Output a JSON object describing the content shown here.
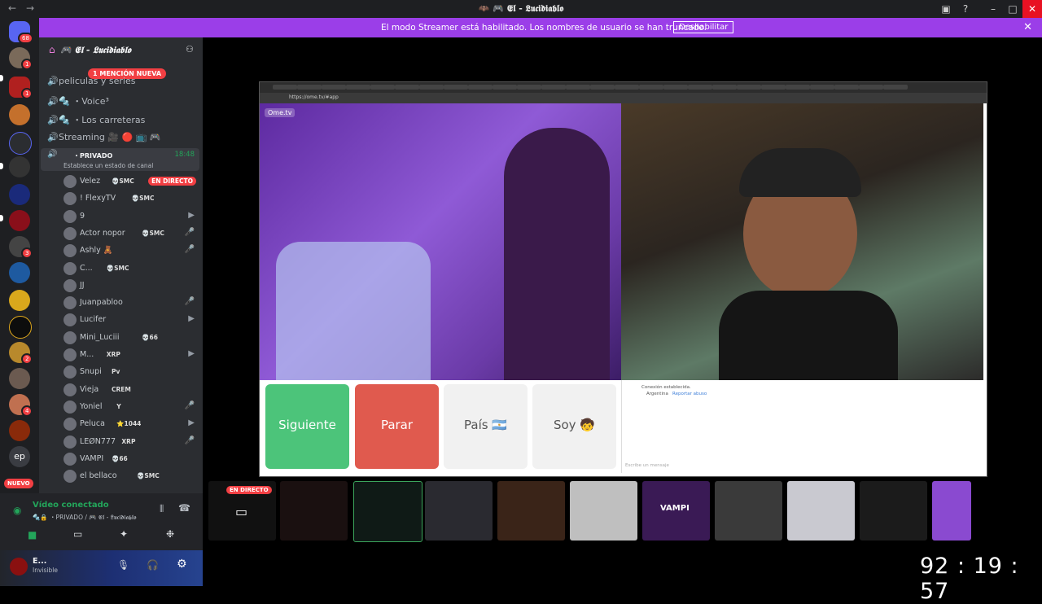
{
  "window": {
    "title": "🦇 🎮 𝕰𝖑 - 𝕷𝖚𝖈𝖎𝖉𝖎𝖆𝖇𝖑𝖔"
  },
  "banner": {
    "message": "El modo Streamer está habilitado. Los nombres de usuario se han truncado.",
    "button": "Deshabilitar"
  },
  "rail": {
    "badges": [
      "68",
      "1",
      "1",
      "3",
      "2",
      "4"
    ],
    "new_label": "NUEVO"
  },
  "server": {
    "name": "🎮 𝕰𝖑 - 𝕷𝖚𝖈𝖎𝖉𝖎𝖆𝖇𝖑𝖔"
  },
  "mention_pill": "1 MENCIÓN NUEVA",
  "channels": [
    {
      "name": "peliculas y series"
    },
    {
      "name": "🔩 ・Voice³"
    },
    {
      "name": "🔩 ・Los carreteras"
    },
    {
      "name": "Streaming 🎥 🔴 📺 🎮"
    }
  ],
  "private_channel": {
    "name": "・PRIVADO",
    "time": "18:48",
    "status": "Establece un estado de canal"
  },
  "members": [
    {
      "name": "Velez",
      "tag": "💀SMC",
      "live": "EN DIRECTO"
    },
    {
      "name": "! FlexyTV",
      "tag": "💀SMC"
    },
    {
      "name": "9"
    },
    {
      "name": "Actor nopor",
      "tag": "💀SMC"
    },
    {
      "name": "Ashly 🧸"
    },
    {
      "name": "C...",
      "tag": "💀SMC"
    },
    {
      "name": "JJ"
    },
    {
      "name": "Juanpabloo"
    },
    {
      "name": "Lucifer"
    },
    {
      "name": "Mini_Luciii",
      "tag": "💀66"
    },
    {
      "name": "M...",
      "tag": "XRP"
    },
    {
      "name": "Snupi",
      "tag": "Pv"
    },
    {
      "name": "Vieja",
      "tag": "CREM"
    },
    {
      "name": "Yoniel",
      "tag": "Y"
    },
    {
      "name": "Peluca",
      "tag": "⭐1044"
    },
    {
      "name": "LEØN777",
      "tag": "XRP"
    },
    {
      "name": "VAMPI",
      "tag": "💀66"
    },
    {
      "name": "el bellaco",
      "tag": "💀SMC"
    }
  ],
  "voice": {
    "status": "Vídeo conectado",
    "channel": "🔩🔒 ・PRIVADO / 🎮 𝕰𝖑 - 𝕷𝖚𝖈𝖎𝖉𝖎𝖆𝖇𝖑𝖔"
  },
  "user": {
    "name": "E...",
    "status": "Invisible"
  },
  "browser": {
    "url": "https://ome.tv/#app",
    "logo": "Ome.tv",
    "buttons": {
      "next": "Siguiente",
      "stop": "Parar",
      "country": "País 🇦🇷",
      "gender": "Soy 🧒"
    },
    "chat": {
      "line1": "Conexión establecida.",
      "line2": "Argentina",
      "report": "Reportar abuso",
      "placeholder": "Escribe un mensaje"
    }
  },
  "stream_strip": {
    "live_label": "EN DIRECTO",
    "vampi": "VAMPI"
  },
  "timer": "92 : 19 : 57",
  "colors": {
    "banner": "#9b3ee8",
    "live": "#f23f43",
    "next": "#4cc47a",
    "stop": "#e05a4e"
  }
}
